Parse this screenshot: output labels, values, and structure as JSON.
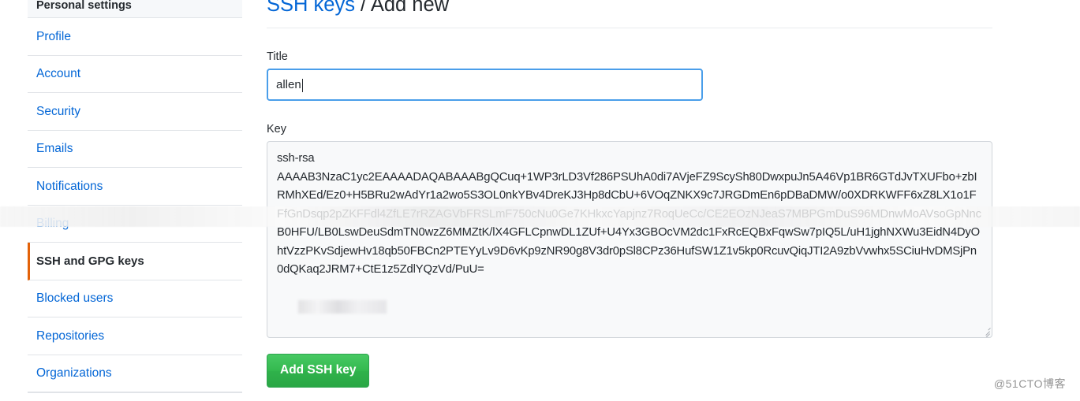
{
  "sidebar": {
    "header": "Personal settings",
    "items": [
      {
        "label": "Profile",
        "active": false
      },
      {
        "label": "Account",
        "active": false
      },
      {
        "label": "Security",
        "active": false
      },
      {
        "label": "Emails",
        "active": false
      },
      {
        "label": "Notifications",
        "active": false
      },
      {
        "label": "Billing",
        "active": false
      },
      {
        "label": "SSH and GPG keys",
        "active": true
      },
      {
        "label": "Blocked users",
        "active": false
      },
      {
        "label": "Repositories",
        "active": false
      },
      {
        "label": "Organizations",
        "active": false
      }
    ],
    "active_accent_color": "#e36209",
    "link_color": "#0366d6"
  },
  "header": {
    "breadcrumb_link": "SSH keys",
    "breadcrumb_separator": " / ",
    "breadcrumb_current": "Add new"
  },
  "form": {
    "title_label": "Title",
    "title_value": "allen",
    "title_placeholder": "",
    "key_label": "Key",
    "key_value": "ssh-rsa\nAAAAB3NzaC1yc2EAAAADAQABAAABgQCuq+1WP3rLD3Vf286PSUhA0di7AVjeFZ9ScySh80DwxpuJn5A46Vp1BR6GTdJvTXUFbo+zbIRMhXEd/Ez0+H5BRu2wAdYr1a2wo5S3OL0nkYBv4DreKJ3Hp8dCbU+6VOqZNKX9c7JRGDmEn6pDBaDMW/o0XDRKWFF6xZ8LX1o1FFfGnDsqp2pZKFFdl4ZfLE7rRZAGVbFRSLmF750cNu0Ge7KHkxcYapjnz7RoqUeCc/CE2EOzNJeaS7MBPGmDuS96MDnwMoAVsoGpNncB0HFU/LB0LswDeuSdmTN0wzZ6MMZtK/lX4GFLCpnwDL1ZUf+U4Yx3GBOcVM2dc1FxRcEQBxFqwSw7pIQ5L/uH1jghNXWu3EidN4DyOhtVzzPKvSdjewHv18qb50FBCn2PTEYyLv9D6vKp9zNR90g8V3dr0pSl8CPz36HufSW1Z1v5kp0RcuvQiqJTI2A9zbVvwhx5SCiuHvDMSjPn0dQKaq2JRM7+CtE1z5ZdlYQzVd/PuU=",
    "key_placeholder": "",
    "submit_label": "Add SSH key",
    "focus_border_color": "#4a9eea",
    "submit_color": "#2ea44f"
  },
  "watermark": {
    "corner_text": "@51CTO博客"
  }
}
